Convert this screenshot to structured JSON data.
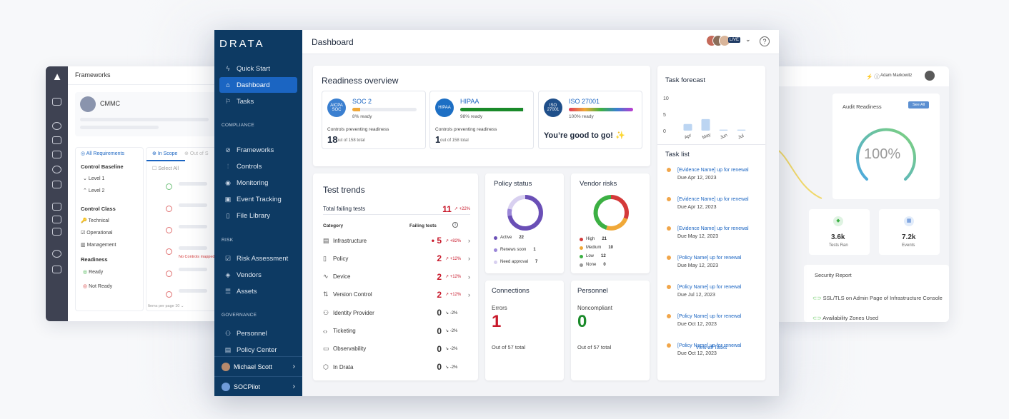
{
  "back_left": {
    "title": "Frameworks",
    "framework": "CMMC",
    "all_requirements": "All Requirements",
    "in_scope": "In Scope",
    "out_scope": "Out of S",
    "select_all": "Select All",
    "control_baseline": "Control Baseline",
    "level1": "Level 1",
    "level2": "Level 2",
    "control_class": "Control Class",
    "technical": "Technical",
    "operational": "Operational",
    "management": "Management",
    "readiness": "Readiness",
    "ready": "Ready",
    "not_ready": "Not Ready",
    "no_controls": "No Controls mapped",
    "items_per_page": "Items per page",
    "per_page_value": "10"
  },
  "back_right": {
    "user": "Adam Markowitz",
    "audit_readiness": "Audit Readiness",
    "see_all": "See All",
    "readiness_pct": "100%",
    "tests_ran_value": "3.6k",
    "tests_ran_label": "Tests Ran",
    "events_value": "7.2k",
    "events_label": "Events",
    "security_report": "Security Report",
    "sr_item1": "SSL/TLS on Admin Page of Infrastructure Console",
    "sr_item2": "Availability Zones Used"
  },
  "sidebar": {
    "logo": "DRATA",
    "quick_start": "Quick Start",
    "dashboard": "Dashboard",
    "tasks": "Tasks",
    "compliance": "COMPLIANCE",
    "frameworks": "Frameworks",
    "controls": "Controls",
    "monitoring": "Monitoring",
    "event_tracking": "Event Tracking",
    "file_library": "File Library",
    "risk": "RISK",
    "risk_assessment": "Risk Assessment",
    "vendors": "Vendors",
    "assets": "Assets",
    "governance": "GOVERNANCE",
    "personnel": "Personnel",
    "policy_center": "Policy Center",
    "user": "Michael Scott",
    "socpilot": "SOCPilot"
  },
  "header": {
    "title": "Dashboard",
    "live": "LIVE",
    "help": "?"
  },
  "readiness": {
    "title": "Readiness overview",
    "frameworks": [
      {
        "name": "SOC 2",
        "icon": "AICPA SOC",
        "pct": "8% ready",
        "fill": 0.12,
        "color": "#f0a838",
        "cp": "Controls preventing readiness",
        "num": "18",
        "of": "out of 158 total"
      },
      {
        "name": "HIPAA",
        "icon": "HIPAA",
        "pct": "98% ready",
        "fill": 0.98,
        "color": "#1a8a2a",
        "cp": "Controls preventing readiness",
        "num": "1",
        "of": "out of 158 total"
      },
      {
        "name": "ISO 27001",
        "icon": "ISO 27001",
        "pct": "100% ready",
        "fill": 1.0,
        "color": "gradient",
        "good": "You’re good to go! ✨"
      }
    ]
  },
  "test_trends": {
    "title": "Test trends",
    "total_label": "Total failing tests",
    "total_value": "11",
    "total_delta": "↗ +22%",
    "col_category": "Category",
    "col_failing": "Failing tests",
    "rows": [
      {
        "icon": "▤",
        "label": "Infrastructure",
        "value": "• 5",
        "delta": "↗ +82%",
        "red": true
      },
      {
        "icon": "▯",
        "label": "Policy",
        "value": "2",
        "delta": "↗ +12%",
        "red": true
      },
      {
        "icon": "∿",
        "label": "Device",
        "value": "2",
        "delta": "↗ +12%",
        "red": true
      },
      {
        "icon": "⇅",
        "label": "Version Control",
        "value": "2",
        "delta": "↗ +12%",
        "red": true
      },
      {
        "icon": "⚇",
        "label": "Identity Provider",
        "value": "0",
        "delta": "↘ -2%",
        "red": false
      },
      {
        "icon": "‹›",
        "label": "Ticketing",
        "value": "0",
        "delta": "↘ -2%",
        "red": false
      },
      {
        "icon": "▭",
        "label": "Observability",
        "value": "0",
        "delta": "↘ -2%",
        "red": false
      },
      {
        "icon": "⬡",
        "label": "In Drata",
        "value": "0",
        "delta": "↘ -2%",
        "red": false
      }
    ]
  },
  "policy_status": {
    "title": "Policy status",
    "legend": [
      {
        "label": "Active",
        "value": "22",
        "color": "#6a4fb6"
      },
      {
        "label": "Renews soon",
        "value": "1",
        "color": "#9b87d8"
      },
      {
        "label": "Need approval",
        "value": "7",
        "color": "#d8d0f0"
      }
    ]
  },
  "vendor_risks": {
    "title": "Vendor risks",
    "legend": [
      {
        "label": "High",
        "value": "21",
        "color": "#d43a3a"
      },
      {
        "label": "Medium",
        "value": "10",
        "color": "#f0a838"
      },
      {
        "label": "Low",
        "value": "12",
        "color": "#3cb043"
      },
      {
        "label": "None",
        "value": "0",
        "color": "#999999"
      }
    ]
  },
  "connections": {
    "title": "Connections",
    "sub": "Errors",
    "value": "1",
    "of": "Out of 57 total"
  },
  "personnel": {
    "title": "Personnel",
    "sub": "Noncompliant",
    "value": "0",
    "of": "Out of 57 total"
  },
  "task_forecast": {
    "title": "Task forecast",
    "yticks": [
      "10",
      "5",
      "0"
    ],
    "chart_data": {
      "type": "bar",
      "categories": [
        "Apr",
        "May",
        "Jun",
        "Jul"
      ],
      "values": [
        2,
        3.5,
        0.3,
        0.3
      ],
      "ylim": [
        0,
        10
      ]
    }
  },
  "task_list": {
    "title": "Task list",
    "items": [
      {
        "title": "[Evidence Name] up for renewal",
        "due": "Due Apr 12, 2023"
      },
      {
        "title": "[Evidence Name] up for renewal",
        "due": "Due Apr 12, 2023"
      },
      {
        "title": "[Evidence Name] up for renewal",
        "due": "Due May 12, 2023"
      },
      {
        "title": "[Policy Name] up for renewal",
        "due": "Due May 12, 2023"
      },
      {
        "title": "[Policy Name] up for renewal",
        "due": "Due Jul 12, 2023"
      },
      {
        "title": "[Policy Name] up for renewal",
        "due": "Due Oct 12, 2023"
      },
      {
        "title": "[Policy Name] up for renewal",
        "due": "Due Oct 12, 2023"
      }
    ],
    "view_all": "View all Tasks"
  }
}
